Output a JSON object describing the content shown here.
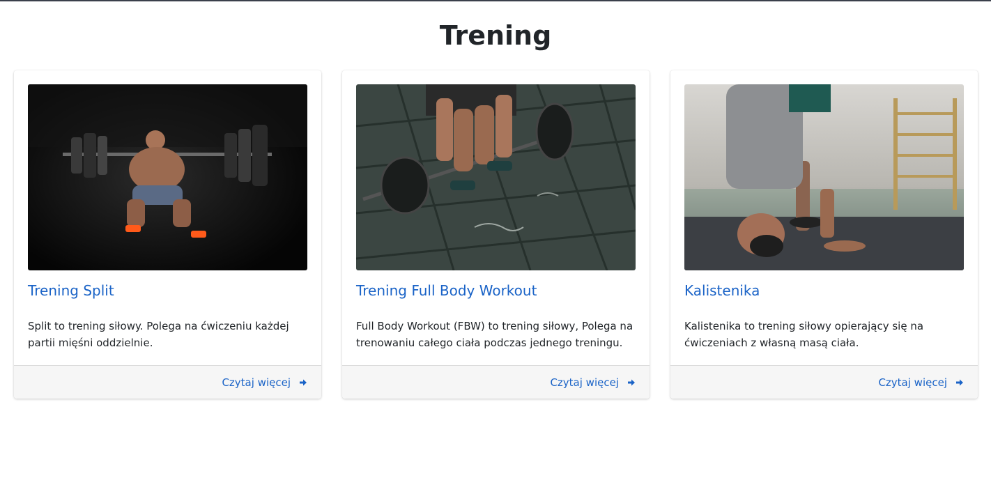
{
  "page": {
    "title": "Trening"
  },
  "cards": [
    {
      "title": "Trening Split",
      "text": "Split to trening siłowy. Polega na ćwiczeniu każdej partii mięśni oddzielnie.",
      "link": "Czytaj więcej",
      "image": "barbell-squat-photo"
    },
    {
      "title": "Trening Full Body Workout",
      "text": "Full Body Workout (FBW) to trening siłowy, Polega na trenowaniu całego ciała podczas jednego treningu.",
      "link": "Czytaj więcej",
      "image": "deadlift-photo"
    },
    {
      "title": "Kalistenika",
      "text": "Kalistenika to trening siłowy opierający się na ćwiczeniach z własną masą ciała.",
      "link": "Czytaj więcej",
      "image": "headstand-photo"
    }
  ],
  "icons": {
    "read_more": "arrow-right-icon"
  },
  "colors": {
    "link": "#1a63c7",
    "title": "#212529",
    "footer_bg": "#f6f6f6"
  }
}
